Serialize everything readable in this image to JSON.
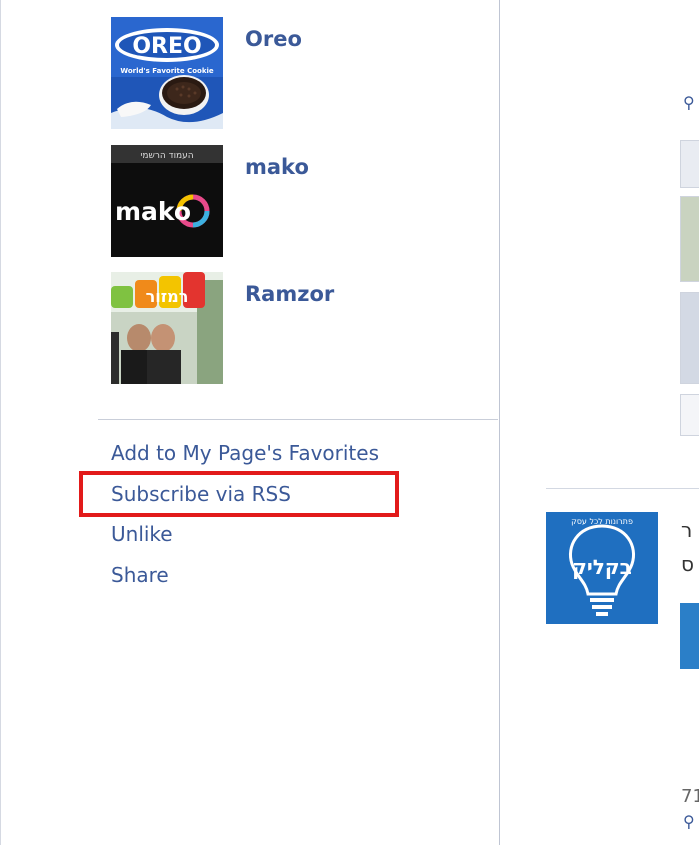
{
  "pages": [
    {
      "name": "Oreo",
      "logo_text": "OREO",
      "logo_subtext": "World's Favorite Cookie"
    },
    {
      "name": "mako",
      "logo_text": "mako",
      "logo_header": "העמוד הרשמי"
    },
    {
      "name": "Ramzor",
      "logo_text": "רמזור"
    }
  ],
  "actions": {
    "add_favorites": "Add to My Page's Favorites",
    "subscribe_rss": "Subscribe via RSS",
    "unlike": "Unlike",
    "share": "Share"
  },
  "right_column": {
    "thumb_text": "בקליק",
    "thumb_subtext": "פתרונות לכל עסק",
    "frag_top": "ר",
    "frag_mid": "ס",
    "frag_bottom": "71"
  },
  "colors": {
    "link": "#3b5998",
    "highlight": "#e21a1a",
    "divider": "#bfc5d3"
  }
}
